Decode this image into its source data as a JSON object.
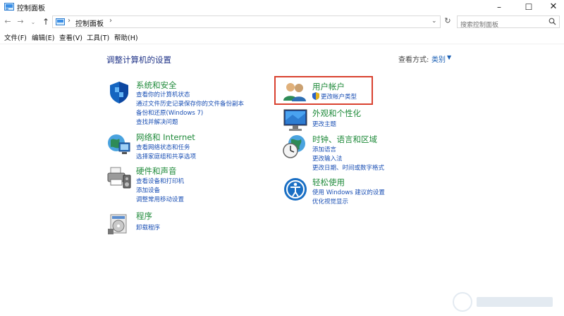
{
  "window": {
    "title": "控制面板",
    "minimize": "–",
    "maximize": "☐",
    "close": "✕"
  },
  "address_bar": {
    "back": "←",
    "forward": "→",
    "recent": "⌄",
    "up": "↑",
    "sep": "›",
    "crumb": "控制面板",
    "dropdown": "⌄",
    "refresh": "↻",
    "search_placeholder": "搜索控制面板"
  },
  "menu": {
    "file": "文件(F)",
    "edit": "编辑(E)",
    "view": "查看(V)",
    "tools": "工具(T)",
    "help": "帮助(H)"
  },
  "main": {
    "title": "调整计算机的设置",
    "view_by_label": "查看方式:",
    "view_by_value": "类别",
    "view_by_caret": "▼"
  },
  "categories_left": [
    {
      "title": "系统和安全",
      "icon": "shield-icon",
      "links": [
        "查看你的计算机状态",
        "通过文件历史记录保存你的文件备份副本",
        "备份和还原(Windows 7)",
        "查找并解决问题"
      ]
    },
    {
      "title": "网络和 Internet",
      "icon": "network-globe-icon",
      "links": [
        "查看网络状态和任务",
        "选择家庭组和共享选项"
      ]
    },
    {
      "title": "硬件和声音",
      "icon": "printer-speaker-icon",
      "links": [
        "查看设备和打印机",
        "添加设备",
        "调整常用移动设置"
      ]
    },
    {
      "title": "程序",
      "icon": "programs-disc-icon",
      "links": [
        "卸载程序"
      ]
    }
  ],
  "categories_right": [
    {
      "title": "用户帐户",
      "icon": "users-icon",
      "links": [
        "更改帐户类型"
      ]
    },
    {
      "title": "外观和个性化",
      "icon": "monitor-icon",
      "links": [
        "更改主题"
      ]
    },
    {
      "title": "时钟、语言和区域",
      "icon": "clock-globe-icon",
      "links": [
        "添加语言",
        "更改输入法",
        "更改日期、时间或数字格式"
      ]
    },
    {
      "title": "轻松使用",
      "icon": "accessibility-icon",
      "links": [
        "使用 Windows 建议的设置",
        "优化视觉显示"
      ]
    }
  ],
  "colors": {
    "category_title": "#1f8a3a",
    "link": "#1a4fb4",
    "highlight_border": "#d9412f",
    "page_title": "#1e3287"
  }
}
